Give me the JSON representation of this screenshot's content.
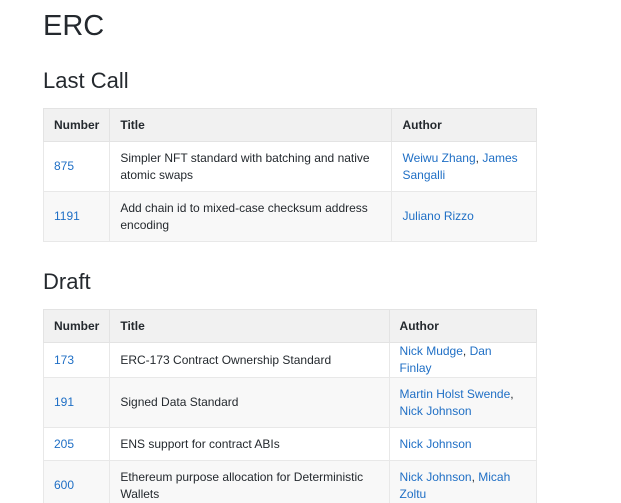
{
  "page": {
    "title": "ERC"
  },
  "sections": {
    "last_call": {
      "heading": "Last Call",
      "columns": [
        "Number",
        "Title",
        "Author"
      ],
      "rows": [
        {
          "number": "875",
          "title": "Simpler NFT standard with batching and native atomic swaps",
          "authors": [
            "Weiwu Zhang",
            "James Sangalli"
          ]
        },
        {
          "number": "1191",
          "title": "Add chain id to mixed-case checksum address encoding",
          "authors": [
            "Juliano Rizzo"
          ]
        }
      ]
    },
    "draft": {
      "heading": "Draft",
      "columns": [
        "Number",
        "Title",
        "Author"
      ],
      "rows": [
        {
          "number": "173",
          "title": "ERC-173 Contract Ownership Standard",
          "authors": [
            "Nick Mudge",
            "Dan Finlay"
          ]
        },
        {
          "number": "191",
          "title": "Signed Data Standard",
          "authors": [
            "Martin Holst Swende",
            "Nick Johnson"
          ]
        },
        {
          "number": "205",
          "title": "ENS support for contract ABIs",
          "authors": [
            "Nick Johnson"
          ]
        },
        {
          "number": "600",
          "title": "Ethereum purpose allocation for Deterministic Wallets",
          "authors": [
            "Nick Johnson",
            "Micah Zoltu"
          ]
        }
      ]
    }
  },
  "colors": {
    "link": "#1f6fc5",
    "header_bg": "#f1f1f1",
    "row_alt_bg": "#f8f8f8",
    "text": "#24292e"
  },
  "separator": ", "
}
